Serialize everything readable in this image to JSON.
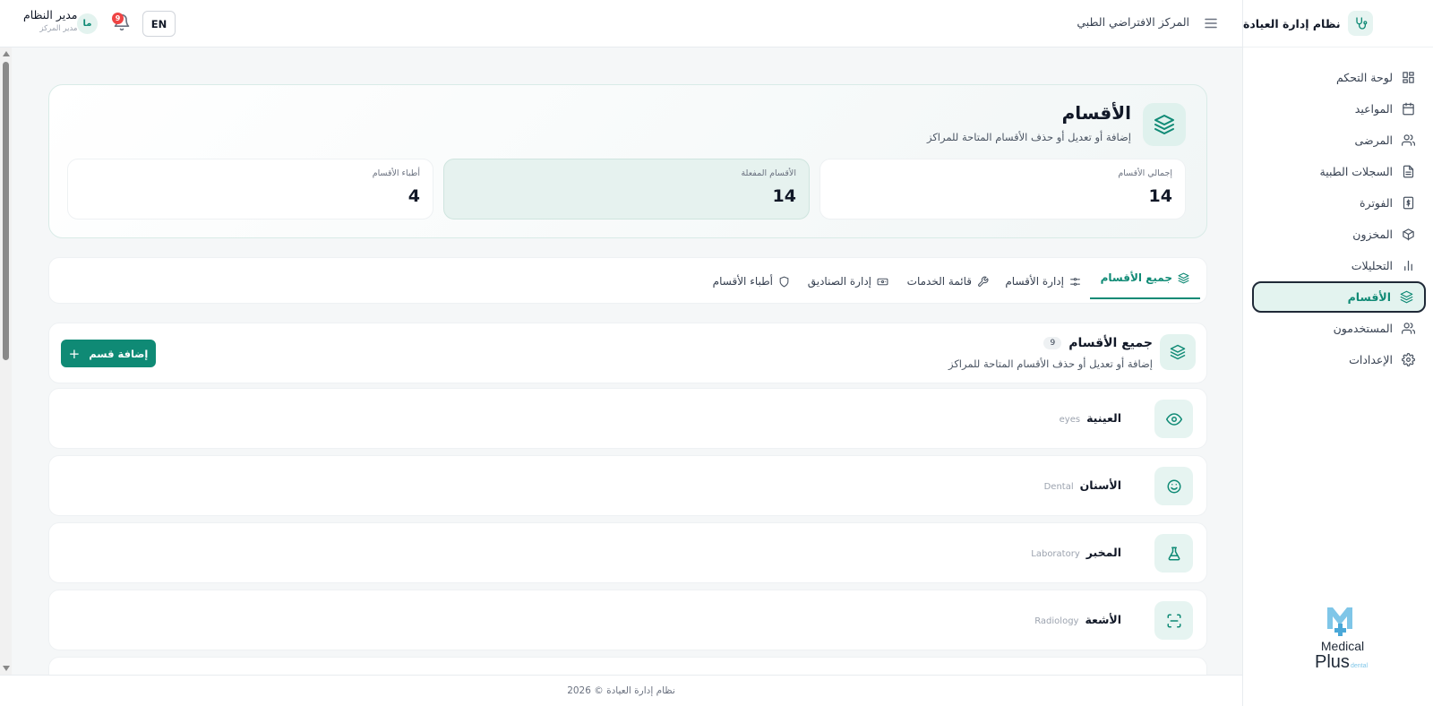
{
  "app": {
    "brand": "نظام إدارة العيادة",
    "center_name": "المركز الافتراضي الطبي",
    "lang_button": "EN",
    "notifications_count": "9",
    "user": {
      "initials": "ما",
      "name": "مدير النظام",
      "role": "مدير المركز"
    },
    "logo_text": {
      "line1": "Medical",
      "line2": "Plus",
      "line3": "dental"
    }
  },
  "sidebar": {
    "items": [
      {
        "label": "لوحة التحكم",
        "icon": "dashboard-icon"
      },
      {
        "label": "المواعيد",
        "icon": "calendar-icon"
      },
      {
        "label": "المرضى",
        "icon": "users-icon"
      },
      {
        "label": "السجلات الطبية",
        "icon": "file-icon"
      },
      {
        "label": "الفوترة",
        "icon": "dollar-icon"
      },
      {
        "label": "المخزون",
        "icon": "box-icon"
      },
      {
        "label": "التحليلات",
        "icon": "bar-chart-icon"
      },
      {
        "label": "الأقسام",
        "icon": "layers-icon",
        "active": true
      },
      {
        "label": "المستخدمون",
        "icon": "users-icon"
      },
      {
        "label": "الإعدادات",
        "icon": "gear-icon"
      }
    ]
  },
  "hero": {
    "title": "الأقسام",
    "subtitle": "إضافة أو تعديل أو حذف الأقسام المتاحة للمراكز",
    "stats": [
      {
        "label": "إجمالي الأقسام",
        "value": "14"
      },
      {
        "label": "الأقسام المفعلة",
        "value": "14"
      },
      {
        "label": "أطباء الأقسام",
        "value": "4"
      }
    ]
  },
  "tabs": [
    {
      "label": "جميع الأقسام",
      "icon": "layers-icon",
      "active": true
    },
    {
      "label": "إدارة الأقسام",
      "icon": "sliders-icon"
    },
    {
      "label": "قائمة الخدمات",
      "icon": "wrench-icon"
    },
    {
      "label": "إدارة الصناديق",
      "icon": "cash-icon"
    },
    {
      "label": "أطباء الأقسام",
      "icon": "shield-icon"
    }
  ],
  "section": {
    "title": "جميع الأقسام",
    "count": "9",
    "subtitle": "إضافة أو تعديل أو حذف الأقسام المتاحة للمراكز",
    "add_button": "إضافة قسم"
  },
  "departments": [
    {
      "name": "العينية",
      "name_en": "eyes",
      "icon": "eye-icon"
    },
    {
      "name": "الأسنان",
      "name_en": "Dental",
      "icon": "smile-icon"
    },
    {
      "name": "المخبر",
      "name_en": "Laboratory",
      "icon": "flask-icon"
    },
    {
      "name": "الأشعة",
      "name_en": "Radiology",
      "icon": "scan-icon"
    }
  ],
  "footer": {
    "text": "نظام إدارة العيادة © 2026"
  },
  "colors": {
    "accent": "#0f8a75",
    "accent_light": "#e3f3ef",
    "badge": "#ef4444"
  }
}
